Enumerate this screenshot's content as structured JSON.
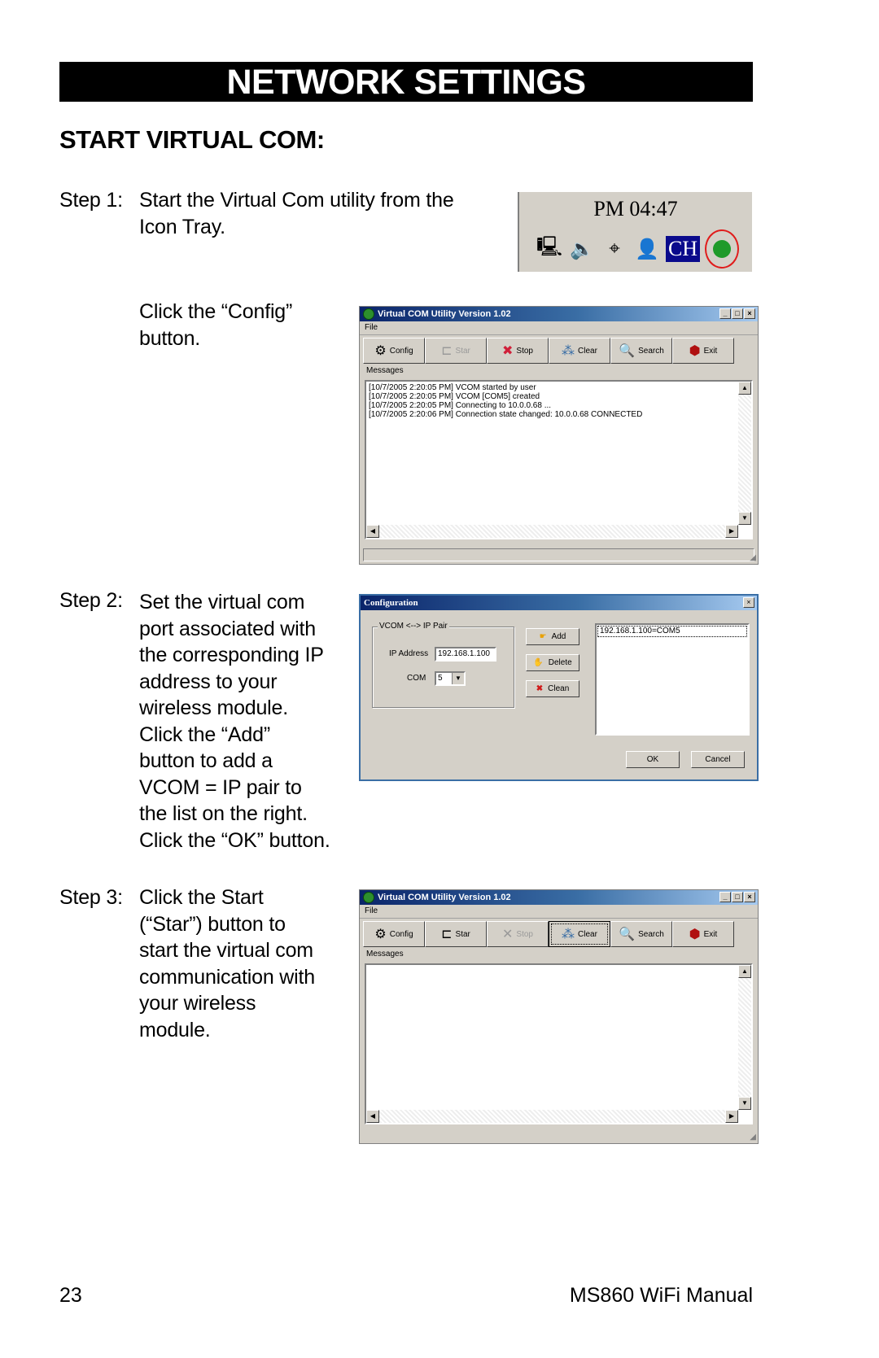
{
  "page": {
    "banner": "NETWORK SETTINGS",
    "section_heading": "START VIRTUAL COM:",
    "footer": {
      "page_number": "23",
      "manual_title": "MS860 WiFi Manual"
    }
  },
  "steps": [
    {
      "label": "Step 1:",
      "lines": [
        "Start the Virtual Com utility from the",
        "Icon Tray."
      ]
    },
    {
      "label": "",
      "lines": [
        "Click the “Config”",
        "button."
      ]
    },
    {
      "label": "Step 2:",
      "lines": [
        "Set the virtual com",
        "port associated with",
        "the corresponding IP",
        "address to your",
        "wireless module.",
        "Click the “Add”",
        "button to add a",
        "VCOM = IP pair to",
        "the list on the right.",
        "Click the “OK” button."
      ]
    },
    {
      "label": "Step 3:",
      "lines": [
        "Click the Start",
        "(“Star”) button to",
        "start the virtual com",
        "communication with",
        "your wireless",
        "module."
      ]
    }
  ],
  "tray": {
    "clock": "PM 04:47",
    "icons": [
      "network-computer-icon",
      "speaker-icon",
      "usb-device-icon",
      "user-network-icon",
      "language-ch-icon",
      "virtual-com-icon"
    ],
    "language_label": "CH",
    "highlight_color": "#e01b1b"
  },
  "utility_window_1": {
    "title": "Virtual COM Utility Version 1.02",
    "menu": [
      "File"
    ],
    "toolbar": [
      {
        "label": "Config",
        "icon": "config-gear-icon",
        "state": "enabled"
      },
      {
        "label": "Star",
        "icon": "plug-icon",
        "state": "disabled"
      },
      {
        "label": "Stop",
        "icon": "stop-plug-icon",
        "state": "enabled"
      },
      {
        "label": "Clear",
        "icon": "clear-icon",
        "state": "enabled"
      },
      {
        "label": "Search",
        "icon": "search-magnifier-icon",
        "state": "enabled"
      },
      {
        "label": "Exit",
        "icon": "exit-icon",
        "state": "enabled"
      }
    ],
    "messages_label": "Messages",
    "messages": [
      "[10/7/2005 2:20:05 PM]  VCOM started by user",
      "[10/7/2005 2:20:05 PM]  VCOM  [COM5]  created",
      "[10/7/2005 2:20:05 PM]  Connecting to 10.0.0.68 ...",
      "[10/7/2005 2:20:06 PM]  Connection state changed: 10.0.0.68 CONNECTED"
    ]
  },
  "config_dialog": {
    "title": "Configuration",
    "group_label": "VCOM <--> IP Pair",
    "ip_label": "IP Address",
    "ip_value": "192.168.1.100",
    "com_label": "COM",
    "com_value": "5",
    "add_label": "Add",
    "delete_label": "Delete",
    "clean_label": "Clean",
    "pairs": [
      "192.168.1.100=COM5"
    ],
    "ok_label": "OK",
    "cancel_label": "Cancel"
  },
  "utility_window_3": {
    "title": "Virtual COM Utility Version 1.02",
    "menu": [
      "File"
    ],
    "toolbar": [
      {
        "label": "Config",
        "icon": "config-gear-icon",
        "state": "enabled"
      },
      {
        "label": "Star",
        "icon": "plug-icon",
        "state": "enabled"
      },
      {
        "label": "Stop",
        "icon": "stop-plug-icon",
        "state": "disabled"
      },
      {
        "label": "Clear",
        "icon": "clear-icon",
        "state": "focused"
      },
      {
        "label": "Search",
        "icon": "search-magnifier-icon",
        "state": "enabled"
      },
      {
        "label": "Exit",
        "icon": "exit-icon",
        "state": "enabled"
      }
    ],
    "messages_label": "Messages",
    "messages": []
  }
}
